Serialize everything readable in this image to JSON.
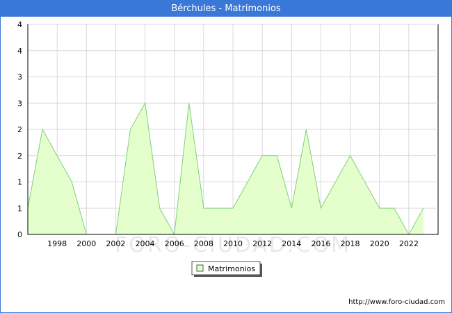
{
  "header": {
    "title": "Bérchules - Matrimonios"
  },
  "watermark": "FORO-CIUDAD.COM",
  "credit": "http://www.foro-ciudad.com",
  "colors": {
    "accent": "#3a78d8",
    "fill": "#e4ffcc",
    "line": "#7fcf7f",
    "grid": "#d8d8d8"
  },
  "chart_data": {
    "type": "area",
    "x": [
      1996,
      1997,
      1998,
      1999,
      2000,
      2001,
      2002,
      2003,
      2004,
      2005,
      2006,
      2007,
      2008,
      2009,
      2010,
      2011,
      2012,
      2013,
      2014,
      2015,
      2016,
      2017,
      2018,
      2019,
      2020,
      2021,
      2022,
      2023
    ],
    "series": [
      {
        "name": "Matrimonios",
        "values": [
          1,
          4,
          3,
          2,
          0,
          0,
          0,
          4,
          5,
          1,
          0,
          5,
          1,
          1,
          1,
          2,
          3,
          3,
          1,
          4,
          1,
          2,
          3,
          2,
          1,
          1,
          0,
          1
        ]
      }
    ],
    "xticks": [
      1998,
      2000,
      2002,
      2004,
      2006,
      2008,
      2010,
      2012,
      2014,
      2016,
      2018,
      2020,
      2022
    ],
    "yticks": [
      {
        "v": 0,
        "label": "0"
      },
      {
        "v": 1,
        "label": "1"
      },
      {
        "v": 2,
        "label": "1"
      },
      {
        "v": 3,
        "label": "2"
      },
      {
        "v": 4,
        "label": "2"
      },
      {
        "v": 5,
        "label": "3"
      },
      {
        "v": 6,
        "label": "3"
      },
      {
        "v": 7,
        "label": "4"
      },
      {
        "v": 8,
        "label": "4"
      }
    ],
    "ylim": [
      0,
      8
    ],
    "xlim": [
      1996,
      2024
    ],
    "grid": true,
    "legend": "bottom-center"
  }
}
